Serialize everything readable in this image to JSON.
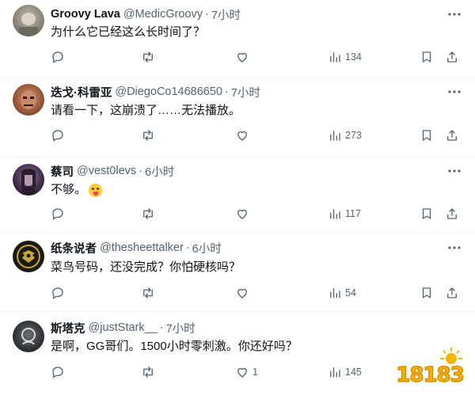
{
  "tweets": [
    {
      "name": "Groovy Lava",
      "handle": "@MedicGroovy",
      "separator": "·",
      "time": "7小时",
      "text": "为什么它已经这么长时间了？",
      "reply_count": "",
      "retweet_count": "",
      "like_count": "",
      "view_count": "134",
      "avatar_icon": "avatar-photo-icon"
    },
    {
      "name": "迭戈·科雷亚",
      "handle": "@DiegoCo14686650",
      "separator": "·",
      "time": "7小时",
      "text": "请看一下，这崩溃了……无法播放。",
      "reply_count": "",
      "retweet_count": "",
      "like_count": "",
      "view_count": "273",
      "avatar_icon": "avatar-photo-icon"
    },
    {
      "name": "蔡司",
      "handle": "@vest0levs",
      "separator": "·",
      "time": "6小时",
      "text": "不够。",
      "reply_count": "",
      "retweet_count": "",
      "like_count": "",
      "view_count": "117",
      "avatar_icon": "avatar-photo-icon"
    },
    {
      "name": "纸条说者",
      "handle": "@thesheettalker",
      "separator": "·",
      "time": "6小时",
      "text": "菜鸟号码，还没完成？你怕硬核吗？",
      "reply_count": "",
      "retweet_count": "",
      "like_count": "",
      "view_count": "54",
      "avatar_icon": "avatar-emblem-icon"
    },
    {
      "name": "斯塔克",
      "handle": "@justStark__",
      "separator": "·",
      "time": "7小时",
      "text": "是啊，GG哥们。1500小时零刺激。你还好吗？",
      "reply_count": "",
      "retweet_count": "",
      "like_count": "1",
      "view_count": "145",
      "avatar_icon": "avatar-photo-icon"
    }
  ],
  "watermark": {
    "text": "18183"
  },
  "colors": {
    "text_primary": "#0f1419",
    "text_secondary": "#536471",
    "divider": "#eff3f4",
    "watermark": "#f2b705"
  }
}
